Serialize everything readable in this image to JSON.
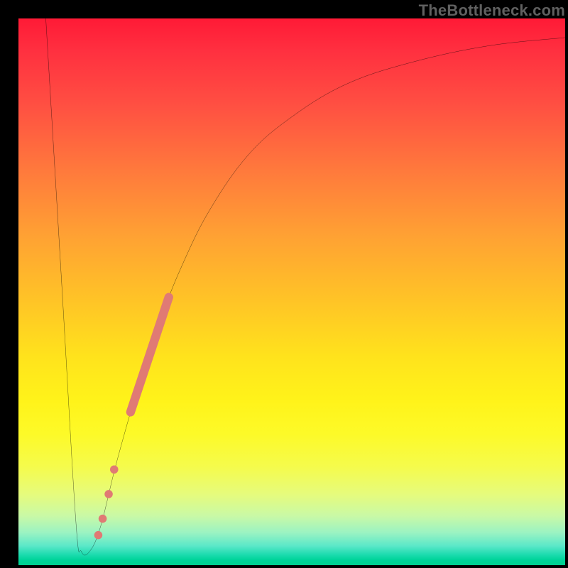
{
  "watermark": "TheBottleneck.com",
  "chart_data": {
    "type": "line",
    "title": "",
    "xlabel": "",
    "ylabel": "",
    "xlim": [
      0,
      100
    ],
    "ylim": [
      0,
      100
    ],
    "grid": false,
    "curve": [
      {
        "x": 5.0,
        "y": 100
      },
      {
        "x": 8.0,
        "y": 50
      },
      {
        "x": 10.5,
        "y": 8
      },
      {
        "x": 11.5,
        "y": 2.5
      },
      {
        "x": 13.0,
        "y": 2.5
      },
      {
        "x": 15.0,
        "y": 7
      },
      {
        "x": 18.0,
        "y": 19
      },
      {
        "x": 22.0,
        "y": 33
      },
      {
        "x": 26.0,
        "y": 45
      },
      {
        "x": 30.0,
        "y": 55
      },
      {
        "x": 35.0,
        "y": 65
      },
      {
        "x": 42.0,
        "y": 75
      },
      {
        "x": 50.0,
        "y": 82
      },
      {
        "x": 60.0,
        "y": 88
      },
      {
        "x": 72.0,
        "y": 92
      },
      {
        "x": 86.0,
        "y": 95
      },
      {
        "x": 100.0,
        "y": 96.5
      }
    ],
    "scatter_thick_segment": {
      "x_start": 20.5,
      "y_start": 28,
      "x_end": 27.5,
      "y_end": 49
    },
    "scatter_points": [
      {
        "x": 17.5,
        "y": 17.5
      },
      {
        "x": 16.5,
        "y": 13
      },
      {
        "x": 15.4,
        "y": 8.5
      },
      {
        "x": 14.6,
        "y": 5.5
      }
    ],
    "colors": {
      "curve": "#000000",
      "scatter": "#e07a74",
      "gradient_top": "#ff1a36",
      "gradient_bottom": "#00d090"
    }
  }
}
